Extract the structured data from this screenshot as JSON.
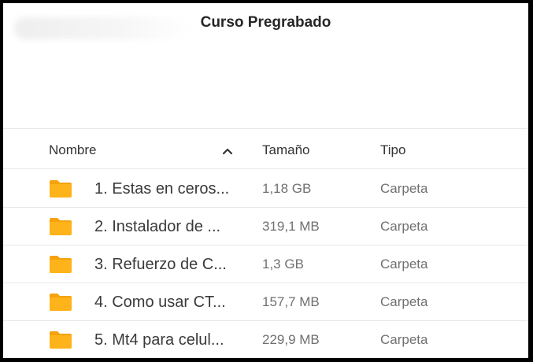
{
  "page": {
    "title": "Curso Pregrabado"
  },
  "table": {
    "columns": {
      "name": "Nombre",
      "size": "Tamaño",
      "type": "Tipo"
    },
    "sort": {
      "column": "Nombre",
      "direction": "ascending",
      "icon": "chevron-up-icon"
    },
    "rows": [
      {
        "name": "1. Estas en ceros...",
        "size": "1,18 GB",
        "type": "Carpeta",
        "icon": "folder-icon"
      },
      {
        "name": "2. Instalador de ...",
        "size": "319,1 MB",
        "type": "Carpeta",
        "icon": "folder-icon"
      },
      {
        "name": "3. Refuerzo de C...",
        "size": "1,3 GB",
        "type": "Carpeta",
        "icon": "folder-icon"
      },
      {
        "name": "4. Como usar CT...",
        "size": "157,7 MB",
        "type": "Carpeta",
        "icon": "folder-icon"
      },
      {
        "name": "5. Mt4 para celul...",
        "size": "229,9 MB",
        "type": "Carpeta",
        "icon": "folder-icon"
      }
    ]
  },
  "colors": {
    "folder": "#ffb31a",
    "folder_tab": "#f5a20c",
    "text_primary": "#3a3a3a",
    "text_secondary": "#707070"
  }
}
